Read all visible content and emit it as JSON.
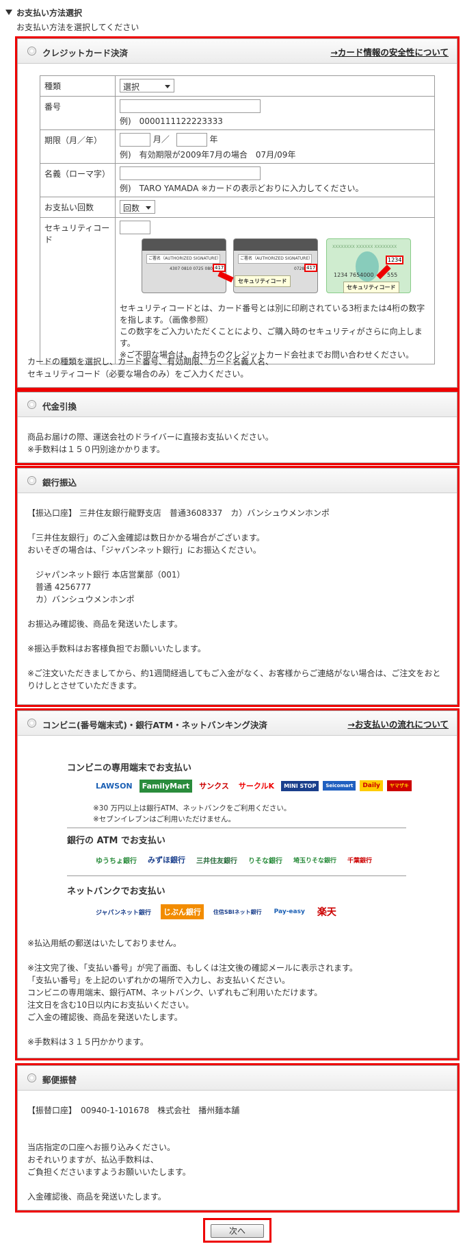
{
  "section": {
    "title": "お支払い方法選択",
    "subtitle": "お支払い方法を選択してください"
  },
  "credit": {
    "title": "クレジットカード決済",
    "link": "→カード情報の安全性について",
    "rows": {
      "type_label": "種類",
      "type_value": "選択",
      "number_label": "番号",
      "number_example": "例)　0000111122223333",
      "expiry_label": "期限（月／年）",
      "month_unit": "月／",
      "year_unit": "年",
      "expiry_example": "例)　有効期限が2009年7月の場合　07月/09年",
      "name_label": "名義（ローマ字）",
      "name_example": "例)　TARO YAMADA ※カードの表示どおりに入力してください。",
      "installments_label": "お支払い回数",
      "installments_value": "回数",
      "security_label": "セキュリティコード",
      "security_desc": "セキュリティコードとは、カード番号とは別に印刷されている3桁または4桁の数字を指します。（画像参照）\nこの数字をご入力いただくことにより、ご購入時のセキュリティがさらに向上します。\n※ご不明な場合は、お持ちのクレジットカード会社までお問い合わせください。"
    },
    "card_images": {
      "sig_text": "ご署名（AUTHORIZED SIGNATURE）",
      "card1_number": "4307 0810 0725 0804",
      "card1_code": "417",
      "card2_number": "0728",
      "card2_code": "417",
      "card3_top": "XXXXXXXX XXXXXX XXXXXXXX",
      "card3_number": "1234  7654000",
      "card3_tail": "555",
      "card3_code": "1234",
      "callout": "セキュリティコード"
    },
    "footer": "カードの種類を選択し、カード番号、有効期限、カード名義人名、\nセキュリティコード（必要な場合のみ）をご入力ください。"
  },
  "cod": {
    "title": "代金引換",
    "text": "商品お届けの際、運送会社のドライバーに直接お支払いください。\n※手数料は１５０円別途かかります。"
  },
  "bank": {
    "title": "銀行振込",
    "text": "【振込口座】 三井住友銀行龍野支店　普通3608337　カ）バンシュウメンホンポ\n\n「三井住友銀行」のご入金確認は数日かかる場合がございます。\nおいそぎの場合は、「ジャパンネット銀行」にお振込ください。\n\n　ジャパンネット銀行 本店営業部（001）\n　普通 4256777\n　カ）バンシュウメンホンポ\n\nお振込み確認後、商品を発送いたします。\n\n※振込手数料はお客様負担でお願いいたします。\n\n※ご注文いただきましてから、約1週間経過してもご入金がなく、お客様からご連絡がない場合は、ご注文をおとりけしとさせていただきます。"
  },
  "conveni": {
    "title": "コンビニ(番号端末式)・銀行ATM・ネットバンキング決済",
    "link": "→お支払いの流れについて",
    "heading1": "コンビニの専用端末でお支払い",
    "stores": [
      "LAWSON",
      "FamilyMart",
      "サンクス",
      "サークルK",
      "MINI STOP",
      "Seicomart",
      "Daily",
      "ヤマザキ"
    ],
    "store_note": "※30 万円以上は銀行ATM、ネットバンクをご利用ください。\n※セブンイレブンはご利用いただけません。",
    "heading2": "銀行の ATM でお支払い",
    "banks": [
      "ゆうちょ銀行",
      "みずほ銀行",
      "三井住友銀行",
      "りそな銀行",
      "埼玉りそな銀行",
      "千葉銀行"
    ],
    "heading3": "ネットバンクでお支払い",
    "netbanks": [
      "ジャパンネット銀行",
      "じぶん銀行",
      "住信SBIネット銀行",
      "Pay-easy",
      "楽天"
    ],
    "text": "※払込用紙の郵送はいたしておりません。\n\n※注文完了後、「支払い番号」が完了画面、もしくは注文後の確認メールに表示されます。\n「支払い番号」を上記のいずれかの場所で入力し、お支払いください。\nコンビニの専用端末、銀行ATM、ネットバンク、いずれもご利用いただけます。\n注文日を含む10日以内にお支払いください。\nご入金の確認後、商品を発送いたします。\n\n※手数料は３１５円かかります。"
  },
  "postal": {
    "title": "郵便振替",
    "text": "【振替口座】　00940-1-101678　株式会社　播州麺本舗\n\n\n当店指定の口座へお振り込みください。\nおそれいりますが、払込手数料は、\nご負担くださいますようお願いいたします。\n\n入金確認後、商品を発送いたします。"
  },
  "next_button": "次へ",
  "colors": {
    "highlight": "#e00000",
    "header_bg": "#ececec"
  }
}
